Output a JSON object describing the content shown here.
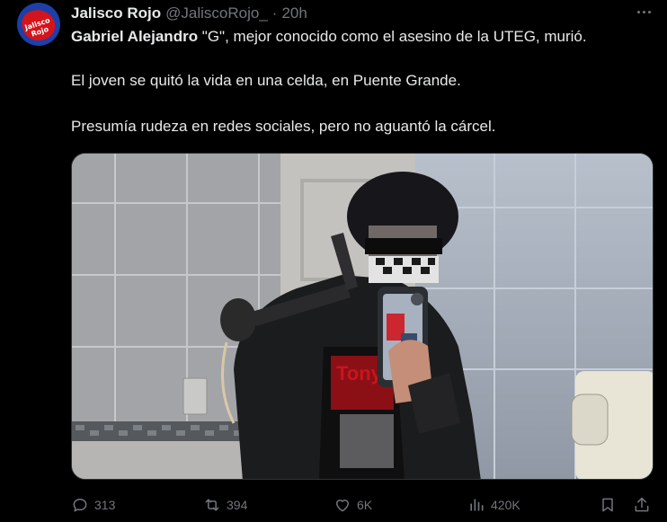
{
  "tweet": {
    "author_name": "Jalisco Rojo",
    "author_handle": "@JaliscoRojo_",
    "separator": "·",
    "time": "20h",
    "avatar_text": "Jalisco Rojo",
    "paragraphs": [
      "Gabriel Alejandro \"G\", mejor conocido como el asesino de la UTEG, murió.",
      "El joven se quitó la vida en una celda, en Puente Grande.",
      "Presumía rudeza en redes sociales, pero no aguantó la cárcel."
    ],
    "image_shirt_text": "Tony"
  },
  "actions": {
    "replies": "313",
    "reposts": "394",
    "likes": "6K",
    "views": "420K"
  },
  "icons": {
    "more": "more-icon",
    "reply": "reply-icon",
    "repost": "repost-icon",
    "like": "heart-icon",
    "views": "views-icon",
    "bookmark": "bookmark-icon",
    "share": "share-icon"
  },
  "colors": {
    "background": "#000000",
    "text": "#e7e9ea",
    "muted": "#71767b",
    "avatar_blue": "#1d3fa8",
    "avatar_red": "#d4141b"
  }
}
